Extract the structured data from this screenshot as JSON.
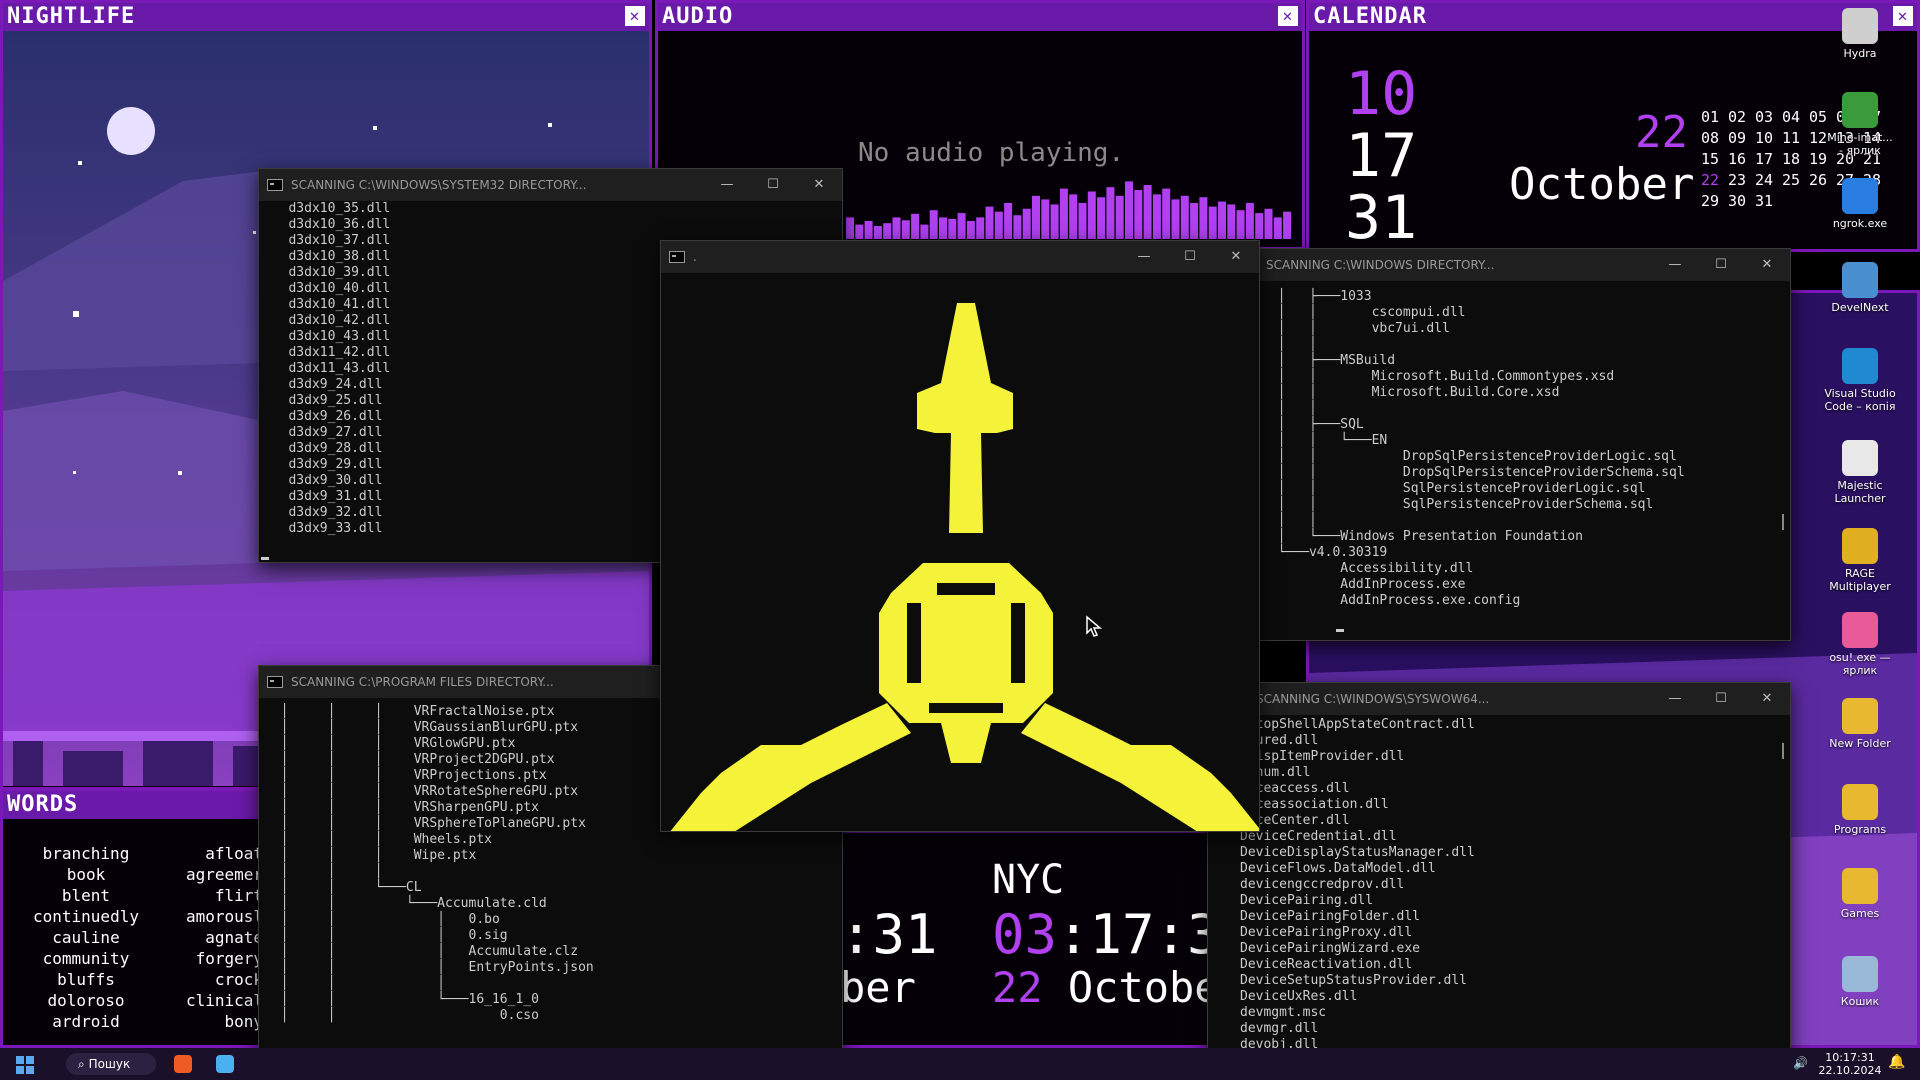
{
  "nightlife": {
    "title": "NIGHTLIFE",
    "close": "✕"
  },
  "audio": {
    "title": "AUDIO",
    "close": "✕",
    "message": "No audio playing.",
    "bars": [
      0.3,
      0.2,
      0.25,
      0.18,
      0.22,
      0.3,
      0.26,
      0.35,
      0.2,
      0.4,
      0.3,
      0.28,
      0.36,
      0.25,
      0.3,
      0.45,
      0.38,
      0.5,
      0.33,
      0.42,
      0.6,
      0.55,
      0.48,
      0.7,
      0.62,
      0.5,
      0.66,
      0.58,
      0.72,
      0.6,
      0.8,
      0.68,
      0.75,
      0.62,
      0.7,
      0.55,
      0.6,
      0.5,
      0.58,
      0.45,
      0.52,
      0.48,
      0.4,
      0.5,
      0.36,
      0.42,
      0.3,
      0.38
    ]
  },
  "calendar": {
    "title": "CALENDAR",
    "close": "✕",
    "hour": "10",
    "minute": "17",
    "second": "31",
    "day": "22",
    "month": "October",
    "grid": [
      [
        "01",
        "02",
        "03",
        "04",
        "05",
        "06",
        "07"
      ],
      [
        "08",
        "09",
        "10",
        "11",
        "12",
        "13",
        "14"
      ],
      [
        "15",
        "16",
        "17",
        "18",
        "19",
        "20",
        "21"
      ],
      [
        "22",
        "23",
        "24",
        "25",
        "26",
        "27",
        "28"
      ],
      [
        "29",
        "30",
        "31",
        "",
        "",
        "",
        ""
      ]
    ]
  },
  "words": {
    "title": "WORDS",
    "col1": [
      "branching",
      "book",
      "blent",
      "continuedly",
      "cauline",
      "community",
      "bluffs",
      "doloroso",
      "ardroid"
    ],
    "col2": [
      "afloat",
      "agreemer",
      "flirt",
      "amorousl",
      "agnate",
      "forgery",
      "crock",
      "clinical",
      "bony"
    ]
  },
  "clock": {
    "city": "NYC",
    "time_left": ":31",
    "date_left": "ber",
    "time_hm": "03",
    "time_rest": ":17:3",
    "date_day": "22",
    "date_month": "Octobe"
  },
  "console_sys32": {
    "title": "SCANNING C:\\WINDOWS\\SYSTEM32 DIRECTORY...",
    "lines": [
      "   d3dx10_35.dll",
      "   d3dx10_36.dll",
      "   d3dx10_37.dll",
      "   d3dx10_38.dll",
      "   d3dx10_39.dll",
      "   d3dx10_40.dll",
      "   d3dx10_41.dll",
      "   d3dx10_42.dll",
      "   d3dx10_43.dll",
      "   d3dx11_42.dll",
      "   d3dx11_43.dll",
      "   d3dx9_24.dll",
      "   d3dx9_25.dll",
      "   d3dx9_26.dll",
      "   d3dx9_27.dll",
      "   d3dx9_28.dll",
      "   d3dx9_29.dll",
      "   d3dx9_30.dll",
      "   d3dx9_31.dll",
      "   d3dx9_32.dll",
      "   d3dx9_33.dll"
    ]
  },
  "console_progfiles": {
    "title": "SCANNING C:\\PROGRAM FILES DIRECTORY...",
    "lines": [
      "  │     │     │    VRFractalNoise.ptx",
      "  │     │     │    VRGaussianBlurGPU.ptx",
      "  │     │     │    VRGlowGPU.ptx",
      "  │     │     │    VRProject2DGPU.ptx",
      "  │     │     │    VRProjections.ptx",
      "  │     │     │    VRRotateSphereGPU.ptx",
      "  │     │     │    VRSharpenGPU.ptx",
      "  │     │     │    VRSphereToPlaneGPU.ptx",
      "  │     │     │    Wheels.ptx",
      "  │     │     │    Wipe.ptx",
      "  │     │     │",
      "  │     │     └───CL",
      "  │     │         └───Accumulate.cld",
      "  │     │             │   0.bo",
      "  │     │             │   0.sig",
      "  │     │             │   Accumulate.clz",
      "  │     │             │   EntryPoints.json",
      "  │     │             │",
      "  │     │             └───16_16_1_0",
      "  │     │                     0.cso"
    ]
  },
  "console_art": {
    "title": "."
  },
  "console_windows": {
    "title": "SCANNING C:\\WINDOWS DIRECTORY...",
    "lines": [
      "  │   ├───1033",
      "  │   │       cscompui.dll",
      "  │   │       vbc7ui.dll",
      "  │   │",
      "  │   ├───MSBuild",
      "  │   │       Microsoft.Build.Commontypes.xsd",
      "  │   │       Microsoft.Build.Core.xsd",
      "  │   │",
      "  │   ├───SQL",
      "  │   │   └───EN",
      "  │   │           DropSqlPersistenceProviderLogic.sql",
      "  │   │           DropSqlPersistenceProviderSchema.sql",
      "  │   │           SqlPersistenceProviderLogic.sql",
      "  │   │           SqlPersistenceProviderSchema.sql",
      "  │   │",
      "  │   └───Windows Presentation Foundation",
      "  └───v4.0.30319",
      "          Accessibility.dll",
      "          AddInProcess.exe",
      "          AddInProcess.exe.config"
    ]
  },
  "console_syswow": {
    "title": "SCANNING C:\\WINDOWS\\SYSWOW64...",
    "lines": [
      "sktopShellAppStateContract.dll",
      "toured.dll",
      "vDispItemProvider.dll",
      "venum.dll",
      "viceaccess.dll",
      "viceassociation.dll",
      "viceCenter.dll",
      "DeviceCredential.dll",
      "DeviceDisplayStatusManager.dll",
      "DeviceFlows.DataModel.dll",
      "devicengccredprov.dll",
      "DevicePairing.dll",
      "DevicePairingFolder.dll",
      "DevicePairingProxy.dll",
      "DevicePairingWizard.exe",
      "DeviceReactivation.dll",
      "DeviceSetupStatusProvider.dll",
      "DeviceUxRes.dll",
      "devmgmt.msc",
      "devmgr.dll",
      "devobj.dll"
    ]
  },
  "desktop_icons": [
    {
      "label": "Hydra",
      "color": "#cfcfcf"
    },
    {
      "label": "Mine-imat...\n- ярлик",
      "color": "#3a9b3a"
    },
    {
      "label": "ngrok.exe",
      "color": "#2a7de0"
    },
    {
      "label": "DevelNext",
      "color": "#4a8fd0"
    },
    {
      "label": "Visual Studio\nCode – копія",
      "color": "#1f8ad2"
    },
    {
      "label": "Majestic\nLauncher",
      "color": "#e8e8e8"
    },
    {
      "label": "RAGE\nMultiplayer",
      "color": "#e0b020"
    },
    {
      "label": "osu!.exe —\nярлик",
      "color": "#e85a9a"
    },
    {
      "label": "New Folder",
      "color": "#e8b830"
    },
    {
      "label": "Programs",
      "color": "#e8b830"
    },
    {
      "label": "Games",
      "color": "#e8b830"
    },
    {
      "label": "Кошик",
      "color": "#9ab8d8"
    }
  ],
  "taskbar": {
    "search_label": "Пошук",
    "time": "10:17:31",
    "date": "22.10.2024"
  },
  "colors": {
    "accent": "#b040f0",
    "purple_frame": "#7b18b8",
    "art_yellow": "#f4f33a"
  }
}
